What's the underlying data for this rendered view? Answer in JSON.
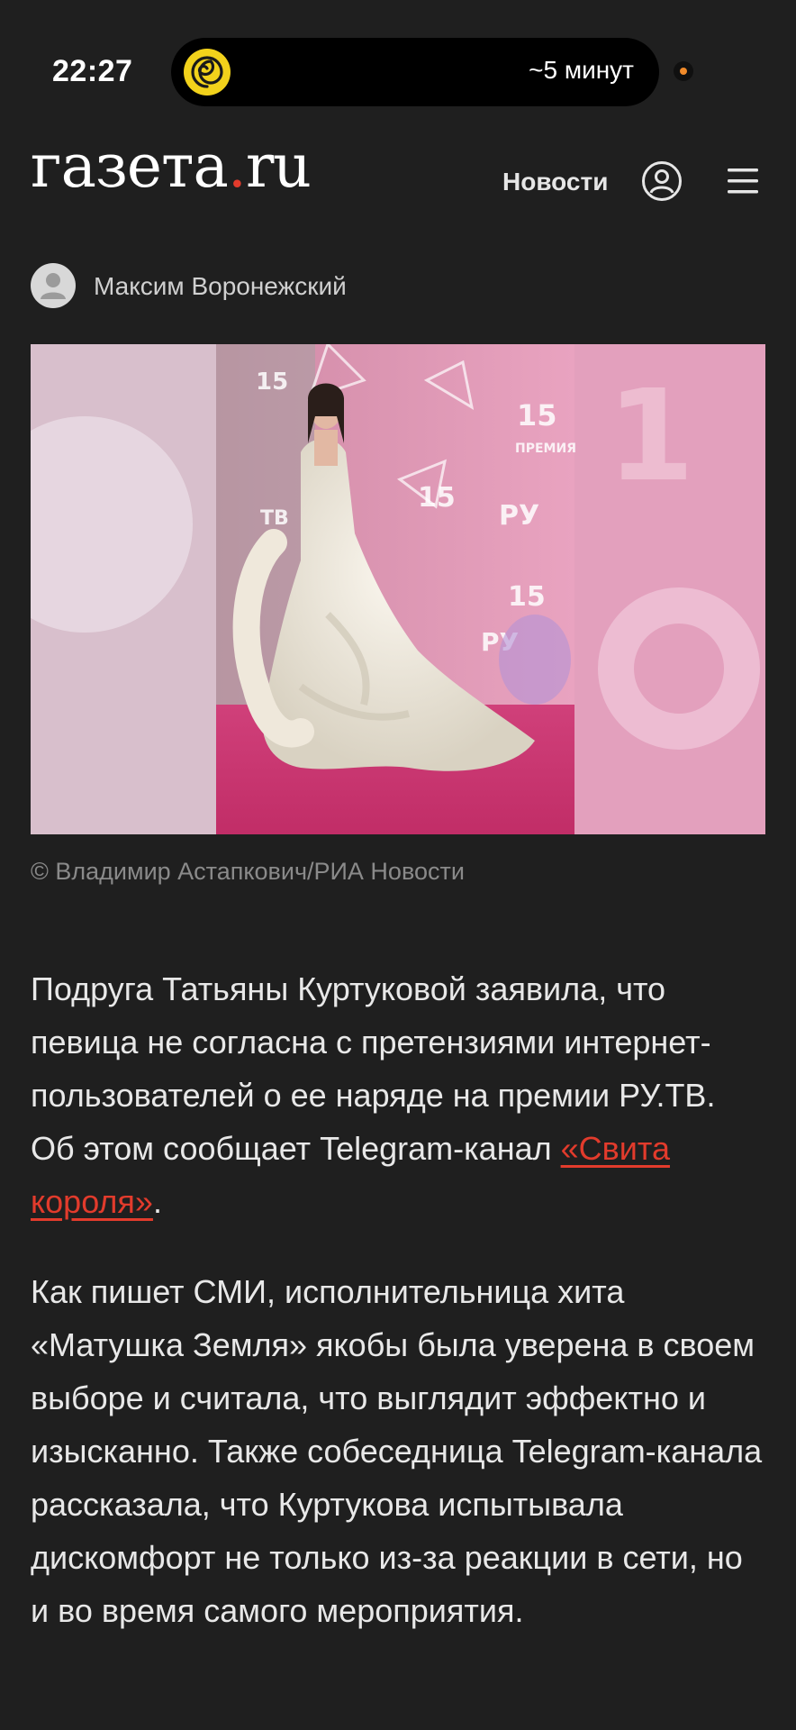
{
  "status_bar": {
    "time": "22:27",
    "island_text": "~5 минут"
  },
  "header": {
    "logo_main": "газета",
    "logo_dot": ".",
    "logo_tld": "ru",
    "nav_news": "Новости"
  },
  "author": {
    "name": "Максим Воронежский"
  },
  "photo": {
    "credit": "© Владимир Астапкович/РИА Новости",
    "backdrop_color": "#e8a9c3"
  },
  "article": {
    "p1_text": "Подруга Татьяны Куртуковой заявила, что певица не согласна с претензиями интернет-пользователей о ее наряде на премии РУ.ТВ. Об этом сообщает Telegram-канал ",
    "p1_link": "«Свита короля»",
    "p1_end": ".",
    "p2_text": "Как пишет СМИ, исполнительница хита «Матушка Земля» якобы была уверена в своем выборе и считала, что выглядит эффектно и изысканно. Также собеседница Telegram-канала рассказала, что Куртукова испытывала дискомфорт не только из-за реакции в сети, но и во время самого мероприятия."
  },
  "colors": {
    "background": "#1f1f1f",
    "accent": "#e23b2c"
  }
}
